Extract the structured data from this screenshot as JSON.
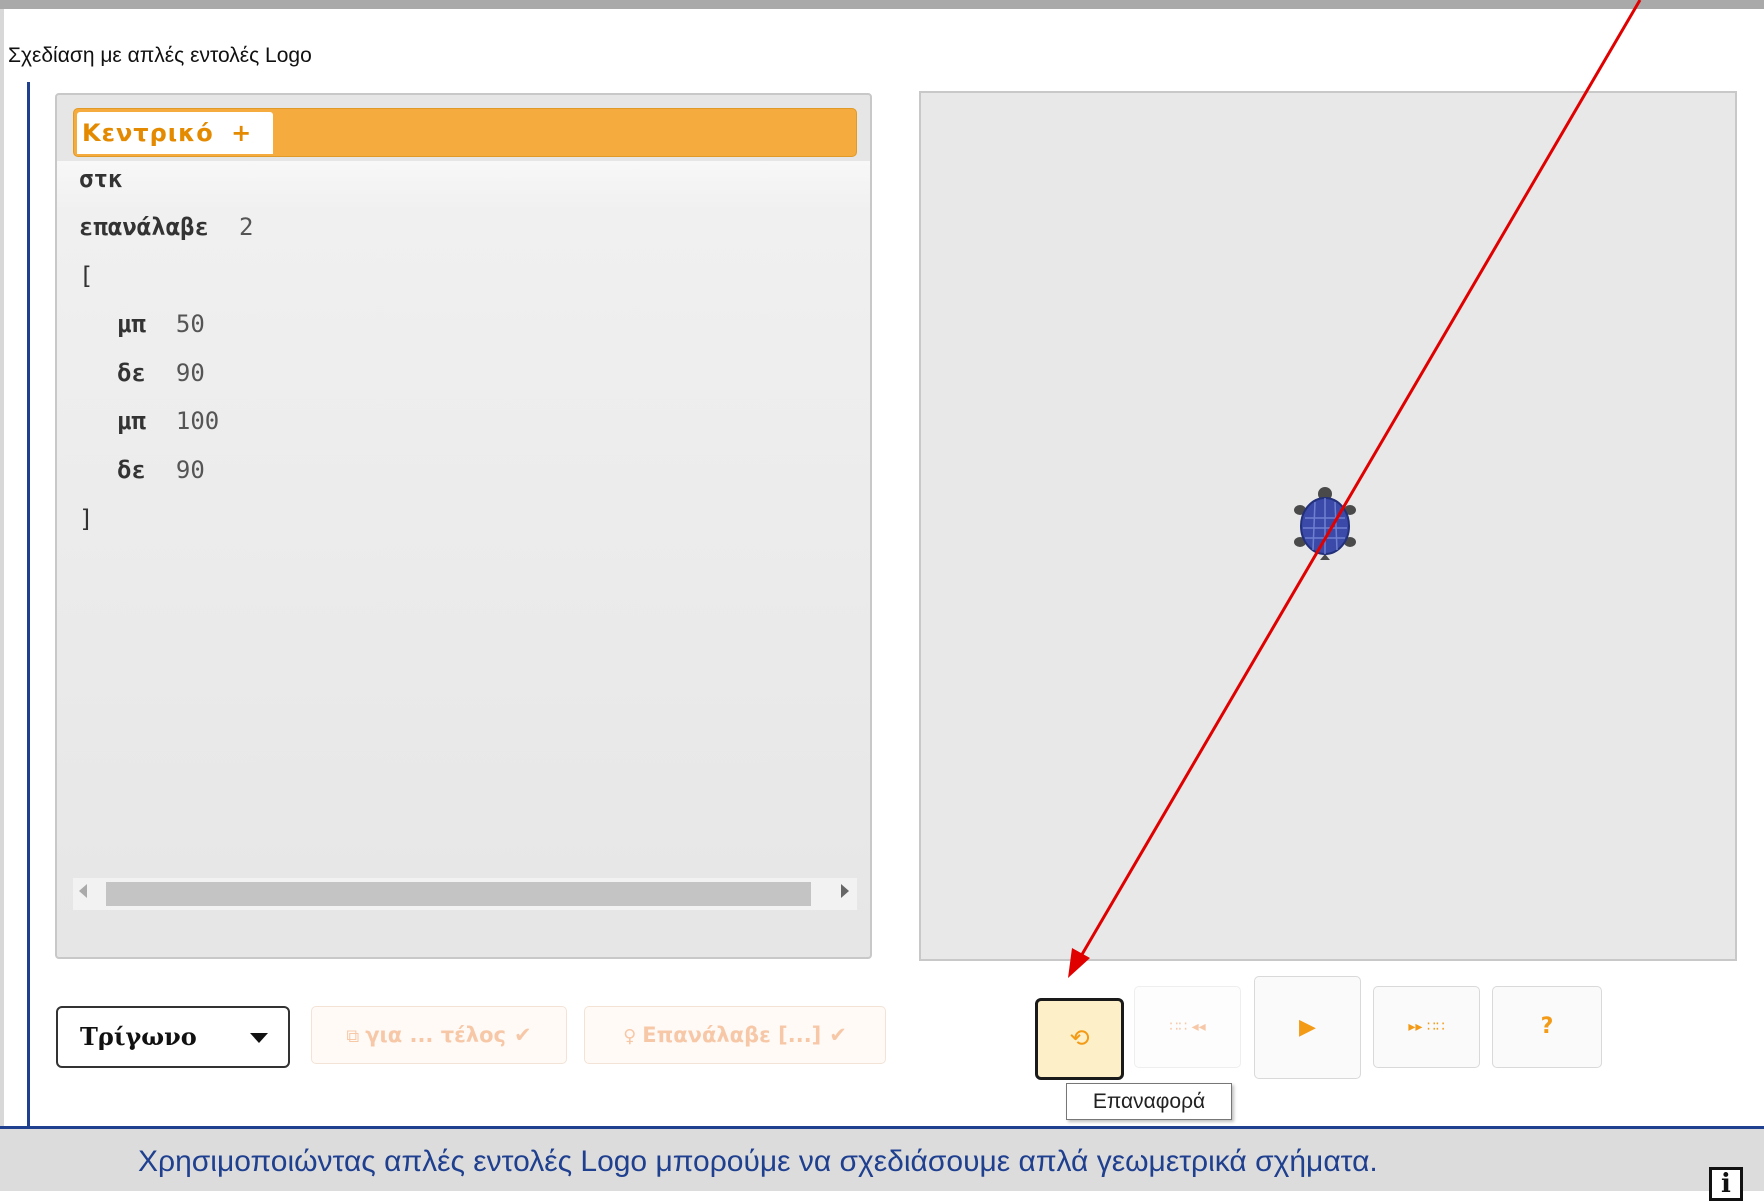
{
  "app": {
    "title": "Σχεδίαση με απλές εντολές Logo"
  },
  "editor": {
    "tab": {
      "label": "Κεντρικό",
      "add": "+"
    },
    "code": [
      {
        "kw": "στκ",
        "arg": ""
      },
      {
        "kw": "επανάλαβε",
        "arg": "2"
      },
      {
        "kw": "[",
        "arg": ""
      },
      {
        "kw": "μπ",
        "arg": "50"
      },
      {
        "kw": "δε",
        "arg": "90"
      },
      {
        "kw": "μπ",
        "arg": "100"
      },
      {
        "kw": "δε",
        "arg": "90"
      },
      {
        "kw": "]",
        "arg": ""
      }
    ]
  },
  "toolbar": {
    "shape_select": {
      "value": "Τρίγωνο"
    },
    "proc_button": {
      "label": "για ... τέλος",
      "check": "✔"
    },
    "repeat_button": {
      "label": "Επανάλαβε [...]",
      "check": "✔"
    }
  },
  "controls": {
    "reset": {
      "icon": "reset-icon",
      "tooltip": "Επαναφορά"
    },
    "step_back": {
      "icon": "step-back-icon"
    },
    "play": {
      "icon": "play-icon"
    },
    "step_forward": {
      "icon": "step-forward-icon"
    },
    "help": {
      "label": "?"
    }
  },
  "footer": {
    "text": "Χρησιμοποιώντας απλές εντολές Logo μπορούμε να σχεδιάσουμε απλά γεωμετρικά σχήματα.",
    "info_label": "i"
  },
  "annotation": {
    "color": "#e00000"
  },
  "colors": {
    "accent": "#f39a16",
    "tab_bar": "#f5ab3d",
    "footer_text": "#1f3f8f",
    "turtle": "#3b4aa8"
  }
}
